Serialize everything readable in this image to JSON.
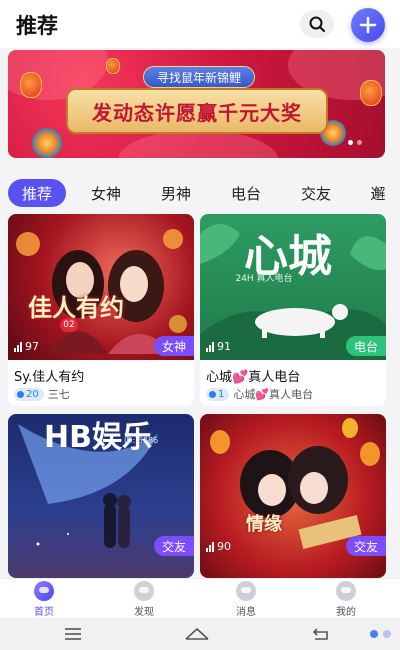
{
  "header": {
    "title": "推荐",
    "search_icon": "search-icon",
    "add_icon": "plus-icon"
  },
  "banner": {
    "tag_text": "寻找鼠年新锦鲤",
    "headline": "发动态许愿赢千元大奖",
    "page_count": 2,
    "active_page": 1
  },
  "tabs": [
    {
      "label": "推荐",
      "active": true
    },
    {
      "label": "女神"
    },
    {
      "label": "男神"
    },
    {
      "label": "电台"
    },
    {
      "label": "交友"
    },
    {
      "label": "邂"
    }
  ],
  "rooms": [
    {
      "title": "Sy.佳人有约",
      "views": "97",
      "category": "女神",
      "listeners": "20",
      "host": "三七",
      "cover_text": "佳人有约",
      "cover_badge": "02"
    },
    {
      "title_prefix": "心城",
      "title_suffix": "真人电台",
      "views": "91",
      "category": "电台",
      "listeners": "1",
      "host_prefix": "心城",
      "host_suffix": "真人电台",
      "cover_text": "心城",
      "cover_sub": "24H 真人电台"
    },
    {
      "views": "",
      "category": "交友",
      "cover_text": "HB娱乐",
      "cover_sub": "ID: 8886"
    },
    {
      "views": "90",
      "category": "交友",
      "cover_text": "情缘"
    }
  ],
  "bottom_nav": [
    {
      "label": "首页",
      "icon": "home-icon",
      "active": true
    },
    {
      "label": "发现",
      "icon": "discover-icon"
    },
    {
      "label": "消息",
      "icon": "message-icon"
    },
    {
      "label": "我的",
      "icon": "profile-icon"
    }
  ],
  "system_nav": {
    "menu_icon": "menu-icon",
    "home_icon": "home-outline-icon",
    "back_icon": "back-icon"
  },
  "colors": {
    "accent": "#5a52f0",
    "female_badge": "#7c4dff",
    "radio_badge": "#2ec37a",
    "banner_red": "#d1183f"
  }
}
